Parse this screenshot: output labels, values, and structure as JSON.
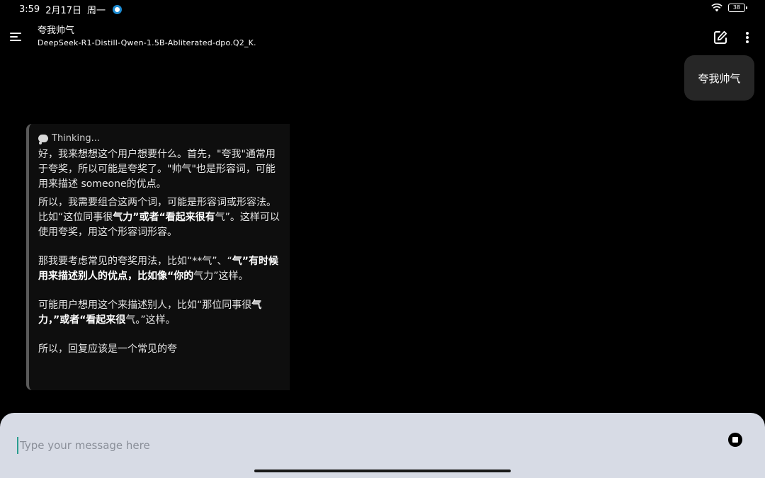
{
  "status_bar": {
    "time": "3:59",
    "date": "2月17日",
    "weekday": "周一",
    "battery": "38"
  },
  "header": {
    "chat_title": "夸我帅气",
    "model_name": "DeepSeek-R1-Distill-Qwen-1.5B-Abliterated-dpo.Q2_K."
  },
  "user_message": "夸我帅气",
  "thinking": {
    "label": "Thinking...",
    "p1": "好，我来想想这个用户想要什么。首先，\"夸我\"通常用于夸奖，所以可能是夸奖了。\"帅气\"也是形容词，可能用来描述 someone的优点。",
    "p2": {
      "a": "所以，我需要组合这两个词，可能是形容词或形容法。比如“这位同事很",
      "b": "气力”或者“看起来很有",
      "c": "气”。这样可以使用夸奖，用这个形容词形容。"
    },
    "p3": {
      "a": "那我要考虑常见的夸奖用法，比如“**气”、“",
      "b": "气”有时候用来描述别人的优点，比如像“你的",
      "c": "气力”这样。"
    },
    "p4": {
      "a": "可能用户想用这个来描述别人，比如“那位同事很",
      "b": "气力，”或者“看起来很",
      "c": "气。”这样。"
    },
    "p5": "所以，回复应该是一个常见的夸"
  },
  "input": {
    "placeholder": "Type your message here"
  },
  "colors": {
    "background": "#000000",
    "input_bar": "#d7dbe5",
    "user_bubble": "#262626",
    "cursor_accent": "#2a9d8f"
  }
}
